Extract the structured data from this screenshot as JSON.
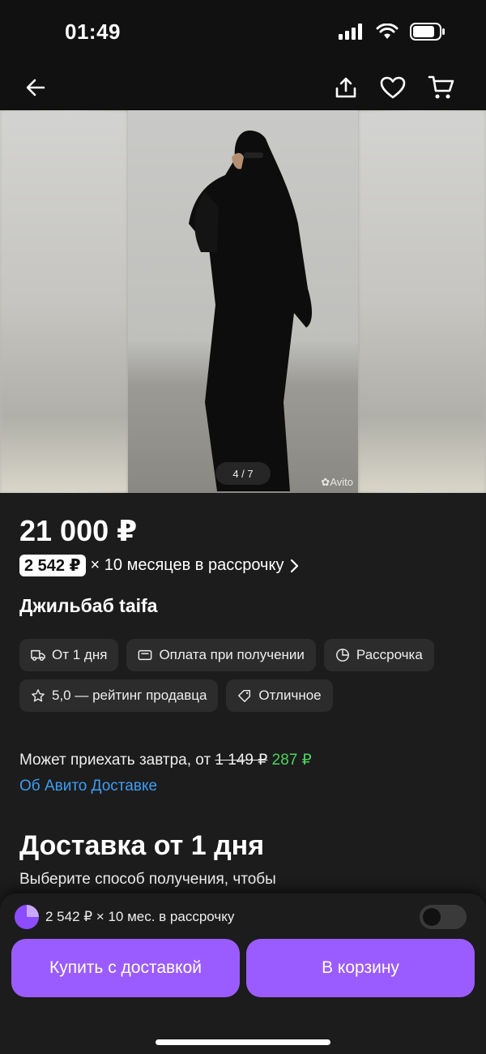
{
  "status_bar": {
    "time": "01:49"
  },
  "app_bar": {
    "icons": [
      "back-arrow-icon",
      "share-icon",
      "heart-icon",
      "cart-icon"
    ]
  },
  "gallery": {
    "counter": "4 / 7",
    "watermark": "Avito"
  },
  "product": {
    "price": "21 000 ₽",
    "installment_amount": "2 542 ₽",
    "installment_text": "× 10 месяцев в рассрочку",
    "title": "Джильбаб taifa"
  },
  "chips": [
    {
      "icon": "truck-icon",
      "label": "От 1 дня"
    },
    {
      "icon": "wallet-icon",
      "label": "Оплата при получении"
    },
    {
      "icon": "pie-chart-icon",
      "label": "Рассрочка"
    },
    {
      "icon": "star-icon",
      "label": "5,0 — рейтинг продавца"
    },
    {
      "icon": "tag-icon",
      "label": "Отличное"
    }
  ],
  "delivery": {
    "text_prefix": "Может приехать завтра, от",
    "old_price": "1 149 ₽",
    "new_price": "287 ₽",
    "link": "Об Авито Доставке"
  },
  "section": {
    "title": "Доставка от 1 дня",
    "subtitle": "Выберите способ получения, чтобы"
  },
  "bottom_sheet": {
    "installment_text": "2 542 ₽ × 10 мес. в рассрочку",
    "toggle_on": false,
    "buy_button": "Купить с доставкой",
    "cart_button": "В корзину"
  },
  "colors": {
    "accent": "#9b5cff",
    "link": "#3d9df5",
    "discount": "#4bd45e",
    "background": "#1c1c1c"
  }
}
